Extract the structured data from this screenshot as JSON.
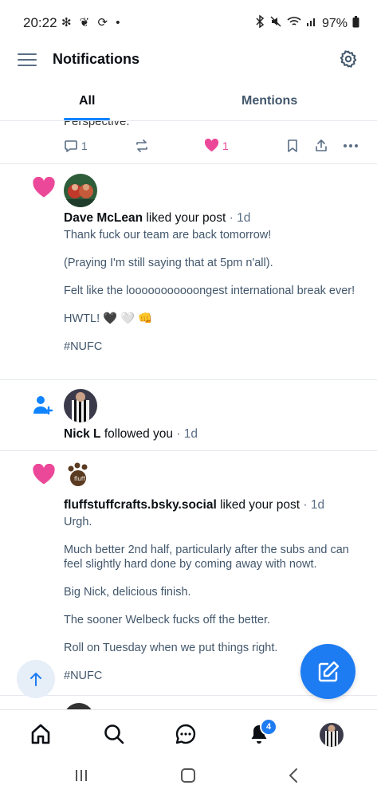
{
  "status_bar": {
    "time": "20:22",
    "left_icons": "✻ ❦ ⟳ •",
    "battery": "97%"
  },
  "header": {
    "title": "Notifications"
  },
  "tabs": {
    "all": "All",
    "mentions": "Mentions"
  },
  "partial_post": {
    "text_fragment": "Perspective.",
    "reply_count": "1",
    "like_count": "1"
  },
  "notifications": [
    {
      "type": "like",
      "user": "Dave McLean",
      "action": "liked your post",
      "ago": "1d",
      "body": [
        "Thank fuck our team are back tomorrow!",
        "(Praying I'm still saying that at 5pm n'all).",
        "Felt like the looooooooooongest international break ever!",
        "HWTL! 🖤 🤍 👊",
        "#NUFC"
      ]
    },
    {
      "type": "follow",
      "user": "Nick L",
      "action": "followed you",
      "ago": "1d"
    },
    {
      "type": "like",
      "user": "fluffstuffcrafts.bsky.social",
      "action": "liked your post",
      "ago": "1d",
      "body": [
        "Urgh.",
        "Much better 2nd half, particularly after the subs and can feel slightly hard done by coming away with nowt.",
        "Big Nick, delicious finish.",
        "The sooner Welbeck fucks off the better.",
        "Roll on Tuesday when we put things right.",
        "#NUFC"
      ]
    }
  ],
  "bottom_nav": {
    "notification_badge": "4"
  },
  "colors": {
    "accent": "#1083fe",
    "like_pink": "#ec4899",
    "compose_blue": "#1e7cf2",
    "muted_text": "#42576c"
  }
}
